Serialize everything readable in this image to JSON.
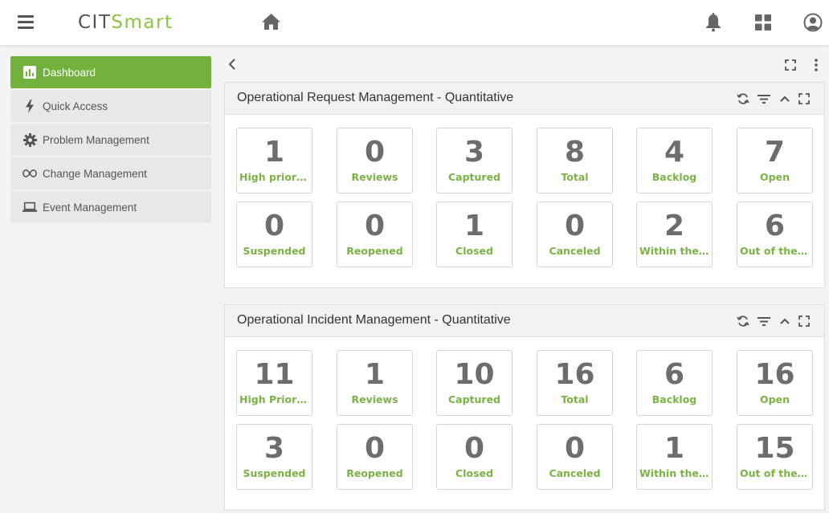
{
  "header": {
    "logo_part1": "CIT",
    "logo_part2": "Smart"
  },
  "sidebar": {
    "items": [
      {
        "label": "Dashboard",
        "icon": "chart-icon"
      },
      {
        "label": "Quick Access",
        "icon": "bolt-icon"
      },
      {
        "label": "Problem Management",
        "icon": "gear-icon"
      },
      {
        "label": "Change Management",
        "icon": "infinity-icon"
      },
      {
        "label": "Event Management",
        "icon": "laptop-icon"
      }
    ]
  },
  "colors": {
    "accent": "#72b13c",
    "label_green": "#7ab344",
    "number_gray": "#6d6d6d"
  },
  "panels": [
    {
      "title": "Operational Request Management - Quantitative",
      "tiles": [
        {
          "value": "1",
          "label": "High priori..."
        },
        {
          "value": "0",
          "label": "Reviews"
        },
        {
          "value": "3",
          "label": "Captured"
        },
        {
          "value": "8",
          "label": "Total"
        },
        {
          "value": "4",
          "label": "Backlog"
        },
        {
          "value": "7",
          "label": "Open"
        },
        {
          "value": "0",
          "label": "Suspended"
        },
        {
          "value": "0",
          "label": "Reopened"
        },
        {
          "value": "1",
          "label": "Closed"
        },
        {
          "value": "0",
          "label": "Canceled"
        },
        {
          "value": "2",
          "label": "Within the..."
        },
        {
          "value": "6",
          "label": "Out of the ..."
        }
      ]
    },
    {
      "title": "Operational Incident Management - Quantitative",
      "tiles": [
        {
          "value": "11",
          "label": "High Priori..."
        },
        {
          "value": "1",
          "label": "Reviews"
        },
        {
          "value": "10",
          "label": "Captured"
        },
        {
          "value": "16",
          "label": "Total"
        },
        {
          "value": "6",
          "label": "Backlog"
        },
        {
          "value": "16",
          "label": "Open"
        },
        {
          "value": "3",
          "label": "Suspended"
        },
        {
          "value": "0",
          "label": "Reopened"
        },
        {
          "value": "0",
          "label": "Closed"
        },
        {
          "value": "0",
          "label": "Canceled"
        },
        {
          "value": "1",
          "label": "Within the..."
        },
        {
          "value": "15",
          "label": "Out of the ..."
        }
      ]
    }
  ]
}
